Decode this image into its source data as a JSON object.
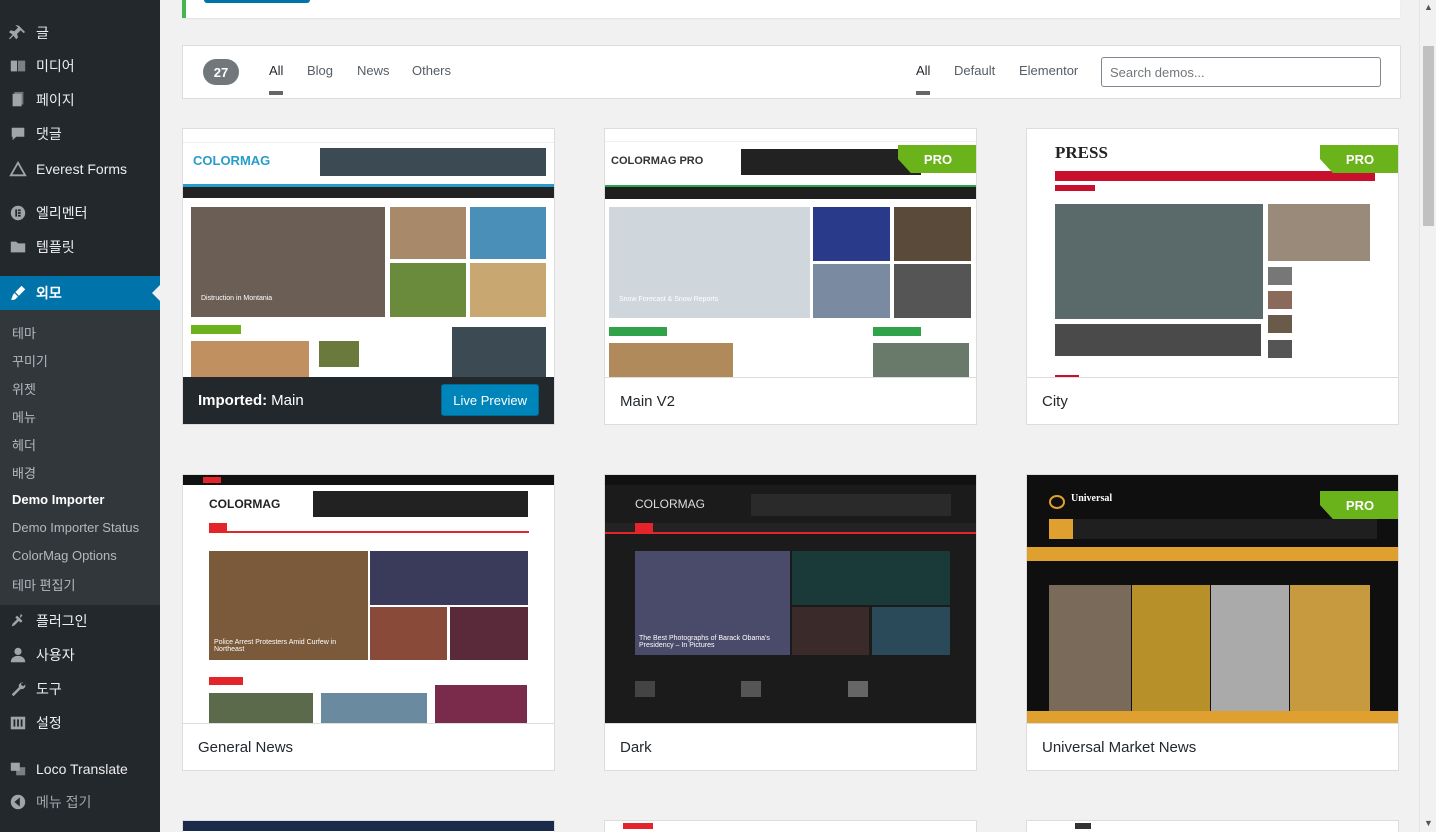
{
  "sidebar": {
    "items": [
      {
        "label": "글",
        "icon": "pin-icon"
      },
      {
        "label": "미디어",
        "icon": "media-icon"
      },
      {
        "label": "페이지",
        "icon": "page-icon"
      },
      {
        "label": "댓글",
        "icon": "comment-icon"
      },
      {
        "label": "Everest Forms",
        "icon": "forms-icon"
      },
      {
        "label": "엘리멘터",
        "icon": "elementor-icon"
      },
      {
        "label": "템플릿",
        "icon": "folder-icon"
      },
      {
        "label": "외모",
        "icon": "brush-icon"
      }
    ],
    "submenu": [
      "테마",
      "꾸미기",
      "위젯",
      "메뉴",
      "헤더",
      "배경",
      "Demo Importer",
      "Demo Importer Status",
      "ColorMag Options",
      "테마 편집기"
    ],
    "items_after": [
      {
        "label": "플러그인",
        "icon": "plugin-icon"
      },
      {
        "label": "사용자",
        "icon": "user-icon"
      },
      {
        "label": "도구",
        "icon": "wrench-icon"
      },
      {
        "label": "설정",
        "icon": "settings-icon"
      },
      {
        "label": "Loco Translate",
        "icon": "translate-icon"
      },
      {
        "label": "메뉴 접기",
        "icon": "collapse-icon"
      }
    ]
  },
  "filter": {
    "count": "27",
    "categories": [
      "All",
      "Blog",
      "News",
      "Others"
    ],
    "builders": [
      "All",
      "Default",
      "Elementor"
    ],
    "search_placeholder": "Search demos..."
  },
  "demos": [
    {
      "name": "Main",
      "imported_label": "Imported:",
      "button": "Live Preview"
    },
    {
      "name": "Main V2",
      "badge": "PRO"
    },
    {
      "name": "City",
      "badge": "PRO"
    },
    {
      "name": "General News"
    },
    {
      "name": "Dark"
    },
    {
      "name": "Universal Market News",
      "badge": "PRO"
    }
  ],
  "thumbs": {
    "colormag": "COLORMAG",
    "colormag_pro": "COLORMAG PRO",
    "press": "PRESS",
    "universal": "Universal",
    "main_headline": "Distruction in Montania",
    "v2_headline": "Snow Forecast & Snow Reports",
    "gn_headline": "Police Arrest Protesters Amid Curfew in Northeast",
    "dark_headline": "The Best Photographs of Barack Obama's Presidency – In Pictures"
  },
  "colors": {
    "sidebar": "#23282d",
    "submenu": "#32373c",
    "accent": "#0073aa",
    "pro": "#6ab31b"
  }
}
